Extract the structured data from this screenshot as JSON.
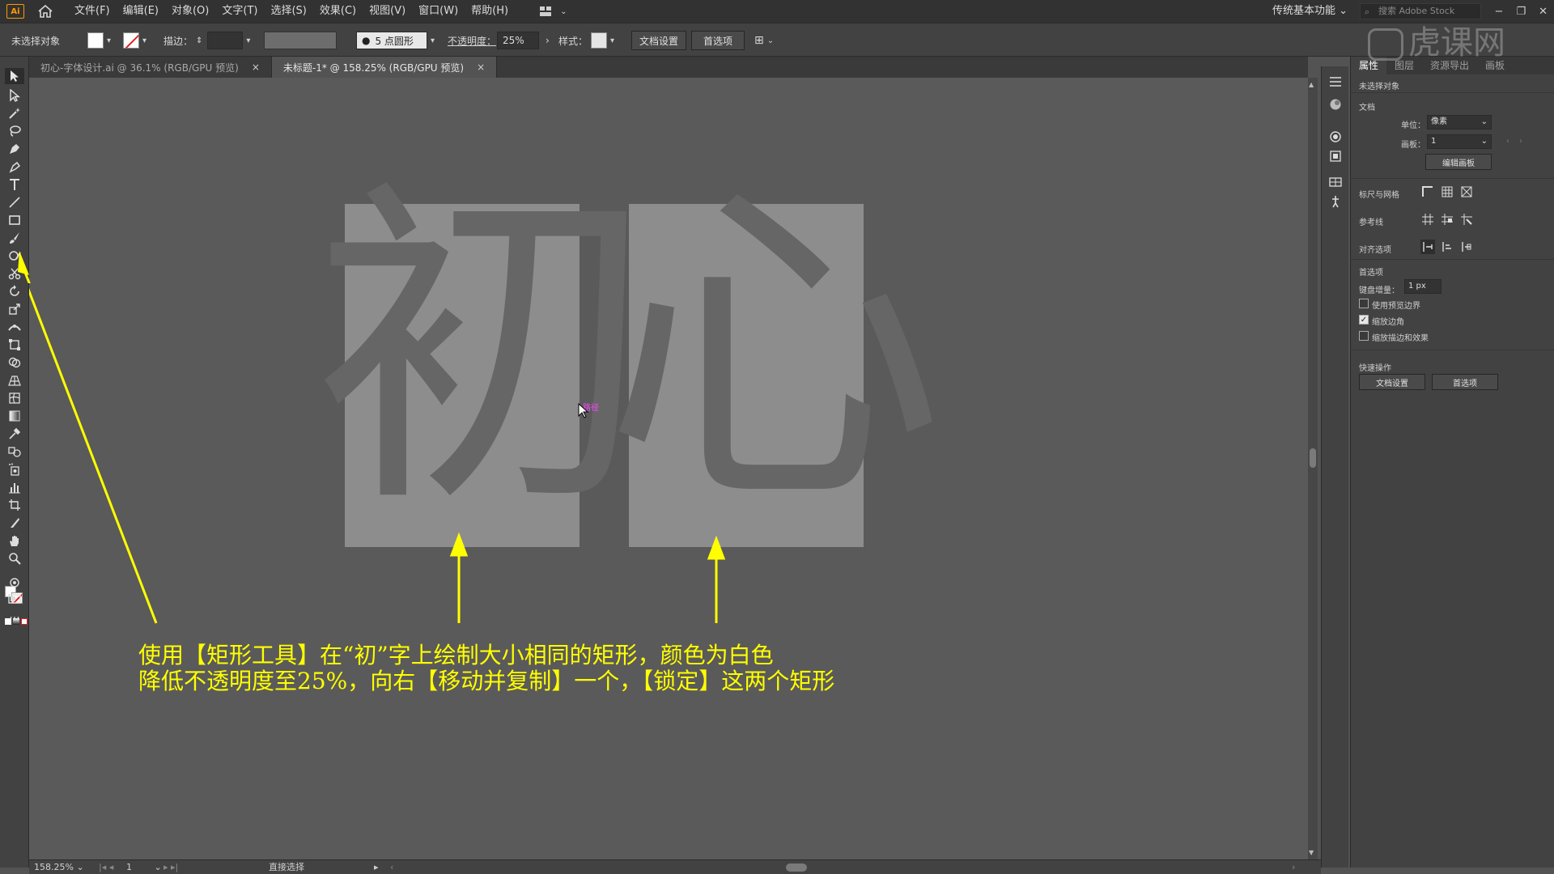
{
  "app": {
    "logo_text": "Ai",
    "menu": [
      "文件(F)",
      "编辑(E)",
      "对象(O)",
      "文字(T)",
      "选择(S)",
      "效果(C)",
      "视图(V)",
      "窗口(W)",
      "帮助(H)"
    ],
    "workspace": "传统基本功能",
    "search_placeholder": "搜索 Adobe Stock",
    "window_controls": [
      "−",
      "❐",
      "✕"
    ]
  },
  "controlbar": {
    "selection_status": "未选择对象",
    "stroke_label": "描边：",
    "brush_label": "5 点圆形",
    "opacity_label": "不透明度：",
    "opacity_value": "25%",
    "style_label": "样式：",
    "doc_setup_button": "文档设置",
    "prefs_button": "首选项"
  },
  "tabs": [
    {
      "label": "初心-字体设计.ai @ 36.1% (RGB/GPU 预览)",
      "close": "×",
      "active": false
    },
    {
      "label": "未标题-1* @ 158.25% (RGB/GPU 预览)",
      "close": "×",
      "active": true
    }
  ],
  "canvas": {
    "glyph_left": "初",
    "glyph_right": "心",
    "smart_guide_label": "路径",
    "annotation_line1": "使用【矩形工具】在“初”字上绘制大小相同的矩形，颜色为白色",
    "annotation_line2": "降低不透明度至25%，向右【移动并复制】一个，【锁定】这两个矩形",
    "annotation_color": "#ffff00"
  },
  "panel": {
    "tabs": [
      "属性",
      "图层",
      "资源导出",
      "画板"
    ],
    "no_selection": "未选择对象",
    "document_section": "文档",
    "unit_label": "单位：",
    "unit_value": "像素",
    "artboard_label": "画板：",
    "artboard_value": "1",
    "edit_artboards_button": "编辑画板",
    "rulers_grids": "标尺与网格",
    "guides": "参考线",
    "snap_options": "对齐选项",
    "preferences_section": "首选项",
    "keyboard_increment_label": "键盘增量：",
    "keyboard_increment_value": "1 px",
    "checkbox_preview_bounds": "使用预览边界",
    "checkbox_scale_corners": "缩放边角",
    "checkbox_scale_strokes": "缩放描边和效果",
    "quick_actions": "快速操作",
    "doc_setup_button": "文档设置",
    "prefs_button": "首选项"
  },
  "statusbar": {
    "zoom": "158.25%",
    "artboard_nav": "1",
    "tool_name": "直接选择"
  },
  "watermark": "虎课网"
}
